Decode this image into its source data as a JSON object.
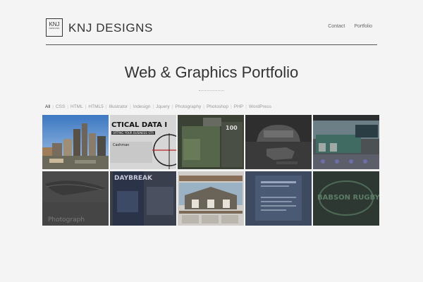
{
  "header": {
    "logo_mark": "KNJ",
    "logo_mark_small": "DESIGNS",
    "logo_text": "KNJ DESIGNS",
    "nav": [
      "Contact",
      "Portfolio"
    ]
  },
  "main": {
    "title": "Web & Graphics Portfolio",
    "filters": [
      "All",
      "CSS",
      "HTML",
      "HTML5",
      "Illustrator",
      "Indesign",
      "Jquery",
      "Photography",
      "Photoshop",
      "PHP",
      "WordPress"
    ],
    "active_filter": "All"
  },
  "portfolio": {
    "items": [
      {
        "id": "city-skyline",
        "text": ""
      },
      {
        "id": "tactical-data",
        "text": "CTICAL DATA I",
        "sub": "ORTING YOUR BUSINESS STR",
        "extra": "Cashman"
      },
      {
        "id": "green-flyer",
        "text": "100"
      },
      {
        "id": "car-map",
        "text": ""
      },
      {
        "id": "storefront-site",
        "text": ""
      },
      {
        "id": "feather-photography",
        "text": "Photograph"
      },
      {
        "id": "brochures",
        "text": "DAYBREAK"
      },
      {
        "id": "house-site",
        "text": ""
      },
      {
        "id": "info-card",
        "text": ""
      },
      {
        "id": "babson-rugby",
        "text": "BABSON RUGBY"
      },
      {
        "id": "tags",
        "text": ""
      }
    ]
  },
  "colors": {
    "accent": "#333333",
    "background": "#f4f4f4"
  }
}
